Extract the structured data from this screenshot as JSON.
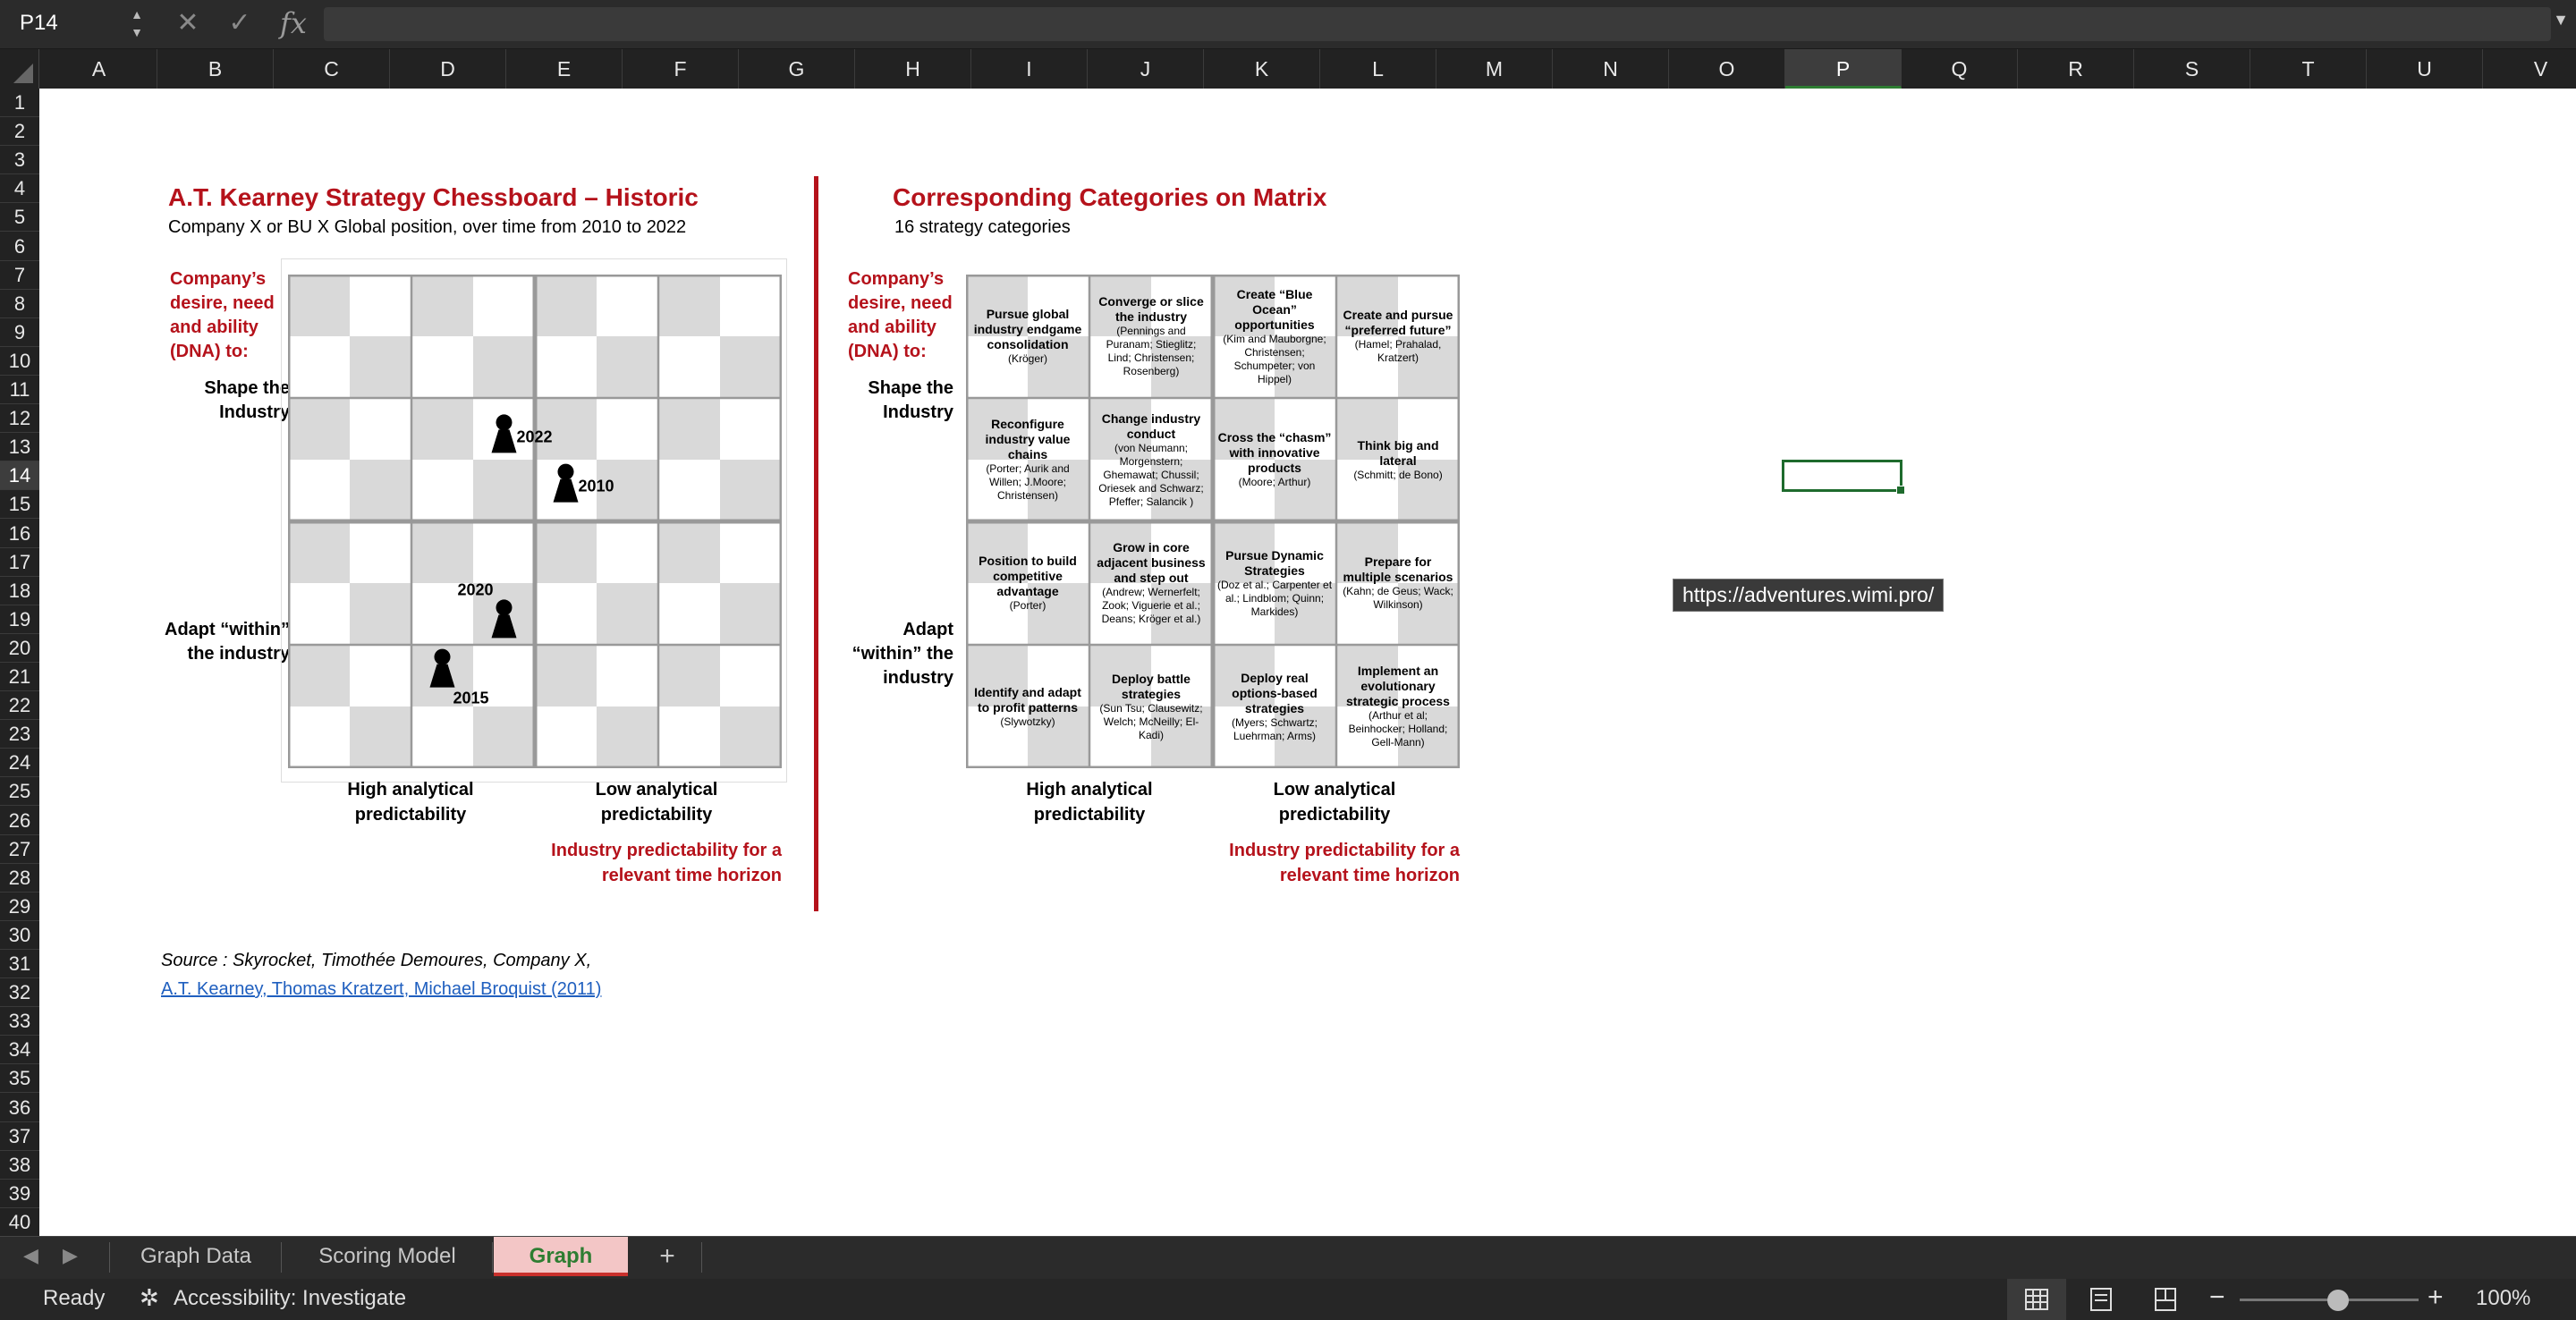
{
  "formula_bar": {
    "cell_ref": "P14",
    "formula": ""
  },
  "columns": [
    "A",
    "B",
    "C",
    "D",
    "E",
    "F",
    "G",
    "H",
    "I",
    "J",
    "K",
    "L",
    "M",
    "N",
    "O",
    "P",
    "Q",
    "R",
    "S",
    "T",
    "U",
    "V"
  ],
  "selected_column": "P",
  "selected_row": "14",
  "rows": [
    "1",
    "2",
    "3",
    "4",
    "5",
    "6",
    "7",
    "8",
    "9",
    "10",
    "11",
    "12",
    "13",
    "14",
    "15",
    "16",
    "17",
    "18",
    "19",
    "20",
    "21",
    "22",
    "23",
    "24",
    "25",
    "26",
    "27",
    "28",
    "29",
    "30",
    "31",
    "32",
    "33",
    "34",
    "35",
    "36",
    "37",
    "38",
    "39",
    "40"
  ],
  "left_panel": {
    "title": "A.T. Kearney Strategy Chessboard – Historic",
    "subtitle": "Company X or BU X Global position, over time from 2010 to 2022",
    "dna_label": "Company’s desire, need and ability (DNA) to:",
    "shape_label": "Shape the Industry",
    "adapt_label": "Adapt “within” the industry",
    "high_label": "High analytical predictability",
    "low_label": "Low analytical predictability",
    "horizon_label": "Industry predictability for a relevant time horizon",
    "pawns": [
      {
        "year": "2022",
        "col": 3.5,
        "row": 2.6
      },
      {
        "year": "2010",
        "col": 4.5,
        "row": 3.4
      },
      {
        "year": "2020",
        "col": 3.5,
        "row": 5.6
      },
      {
        "year": "2015",
        "col": 2.5,
        "row": 6.4
      }
    ]
  },
  "right_panel": {
    "title": "Corresponding Categories on Matrix",
    "subtitle": "16 strategy categories",
    "dna_label": "Company’s desire, need and ability (DNA) to:",
    "shape_label": "Shape the Industry",
    "adapt_label": "Adapt “within” the industry",
    "high_label": "High analytical predictability",
    "low_label": "Low analytical predictability",
    "horizon_label": "Industry predictability for a relevant time horizon",
    "cells": [
      {
        "title": "Pursue global industry endgame consolidation",
        "refs": "(Kröger)"
      },
      {
        "title": "Converge or slice the industry",
        "refs": "(Pennings and Puranam; Stieglitz; Lind; Christensen; Rosenberg)"
      },
      {
        "title": "Create “Blue Ocean” opportunities",
        "refs": "(Kim and Mauborgne; Christensen; Schumpeter; von Hippel)"
      },
      {
        "title": "Create and pursue “preferred future”",
        "refs": "(Hamel; Prahalad, Kratzert)"
      },
      {
        "title": "Reconfigure industry value chains",
        "refs": "(Porter; Aurik and Willen; J.Moore; Christensen)"
      },
      {
        "title": "Change industry conduct",
        "refs": "(von Neumann; Morgenstern; Ghemawat; Chussil; Oriesek and Schwarz; Pfeffer; Salancik )"
      },
      {
        "title": "Cross the “chasm” with innovative products",
        "refs": "(Moore; Arthur)"
      },
      {
        "title": "Think big and lateral",
        "refs": "(Schmitt; de Bono)"
      },
      {
        "title": "Position to build competitive advantage",
        "refs": "(Porter)"
      },
      {
        "title": "Grow in core adjacent business and step out",
        "refs": "(Andrew; Wernerfelt; Zook; Viguerie et al.; Deans; Kröger et al.)"
      },
      {
        "title": "Pursue Dynamic Strategies",
        "refs": "(Doz et al.; Carpenter et al.; Lindblom; Quinn; Markides)"
      },
      {
        "title": "Prepare for multiple scenarios",
        "refs": "(Kahn; de Geus; Wack; Wilkinson)"
      },
      {
        "title": "Identify and adapt to profit patterns",
        "refs": "(Slywotzky)"
      },
      {
        "title": "Deploy battle strategies",
        "refs": "(Sun Tsu; Clausewitz; Welch; McNeilly; El-Kadi)"
      },
      {
        "title": "Deploy real options-based strategies",
        "refs": "(Myers; Schwartz; Luehrman; Arms)"
      },
      {
        "title": "Implement an evolutionary strategic process",
        "refs": "(Arthur et al; Beinhocker; Holland; Gell-Mann)"
      }
    ]
  },
  "source": {
    "line1": "Source : Skyrocket, Timothée Demoures, Company X,",
    "link": "A.T. Kearney, Thomas Kratzert, Michael Broquist (2011)"
  },
  "tooltip": "https://adventures.wimi.pro/",
  "tabs": [
    {
      "label": "Graph Data",
      "active": false
    },
    {
      "label": "Scoring Model",
      "active": false
    },
    {
      "label": "Graph",
      "active": true
    }
  ],
  "add_sheet": "+",
  "status": {
    "ready": "Ready",
    "accessibility": "Accessibility: Investigate",
    "zoom": "100%",
    "zoom_level": 0.5
  }
}
